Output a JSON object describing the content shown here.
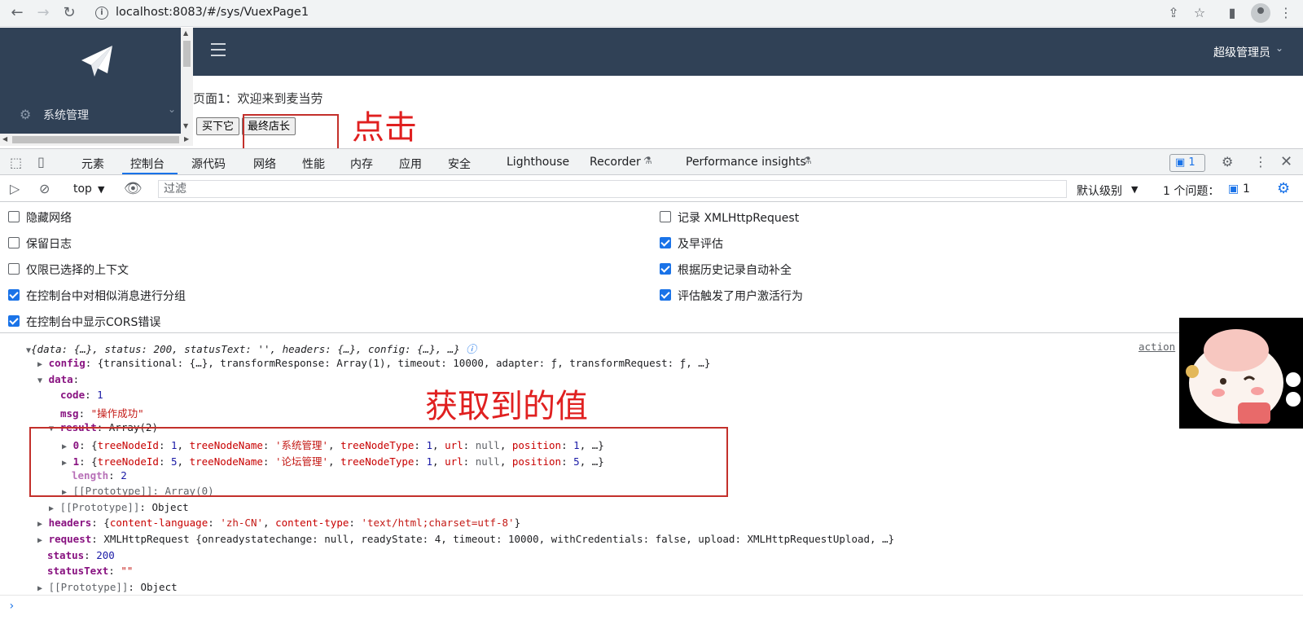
{
  "browser": {
    "url": "localhost:8083/#/sys/VuexPage1"
  },
  "app": {
    "sidebar_menu": "系统管理",
    "user_name": "超级管理员",
    "welcome_text": "页面1：欢迎来到麦当劳",
    "buttons": [
      "买下它",
      "最终店长"
    ]
  },
  "annotations": {
    "click": "点击",
    "value": "获取到的值"
  },
  "devtools": {
    "tabs": [
      "元素",
      "控制台",
      "源代码",
      "网络",
      "性能",
      "内存",
      "应用",
      "安全",
      "Lighthouse",
      "Recorder",
      "Performance insights"
    ],
    "active_tab": "控制台",
    "issues_badge": "1",
    "context": "top",
    "filter_placeholder": "过滤",
    "level": "默认级别",
    "issues_text": "1 个问题：",
    "issues_count": "1",
    "settings_left": [
      {
        "label": "隐藏网络",
        "checked": false
      },
      {
        "label": "保留日志",
        "checked": false
      },
      {
        "label": "仅限已选择的上下文",
        "checked": false
      },
      {
        "label": "在控制台中对相似消息进行分组",
        "checked": true
      },
      {
        "label": "在控制台中显示CORS错误",
        "checked": true
      }
    ],
    "settings_right": [
      {
        "label": "记录 XMLHttpRequest",
        "checked": false
      },
      {
        "label": "及早评估",
        "checked": true
      },
      {
        "label": "根据历史记录自动补全",
        "checked": true
      },
      {
        "label": "评估触发了用户激活行为",
        "checked": true
      }
    ],
    "source_link": "action"
  },
  "console": {
    "summary": "{data: {…}, status: 200, statusText: '', headers: {…}, config: {…}, …}",
    "config_line": "{transitional: {…}, transformResponse: Array(1), timeout: 10000, adapter: ƒ, transformRequest: ƒ, …}",
    "code": "1",
    "msg": "\"操作成功\"",
    "result_type": "Array(2)",
    "items": [
      {
        "index": "0",
        "id": "1",
        "name": "'系统管理'",
        "type": "1",
        "position": "1"
      },
      {
        "index": "1",
        "id": "5",
        "name": "'论坛管理'",
        "type": "1",
        "position": "5"
      }
    ],
    "length": "2",
    "proto_array": "Array(0)",
    "proto_object": "Object",
    "headers_lang": "'zh-CN'",
    "headers_type": "'text/html;charset=utf-8'",
    "request_line": "XMLHttpRequest {onreadystatechange: null, readyState: 4, timeout: 10000, withCredentials: false, upload: XMLHttpRequestUpload, …}",
    "status": "200",
    "status_text": "\"\""
  }
}
